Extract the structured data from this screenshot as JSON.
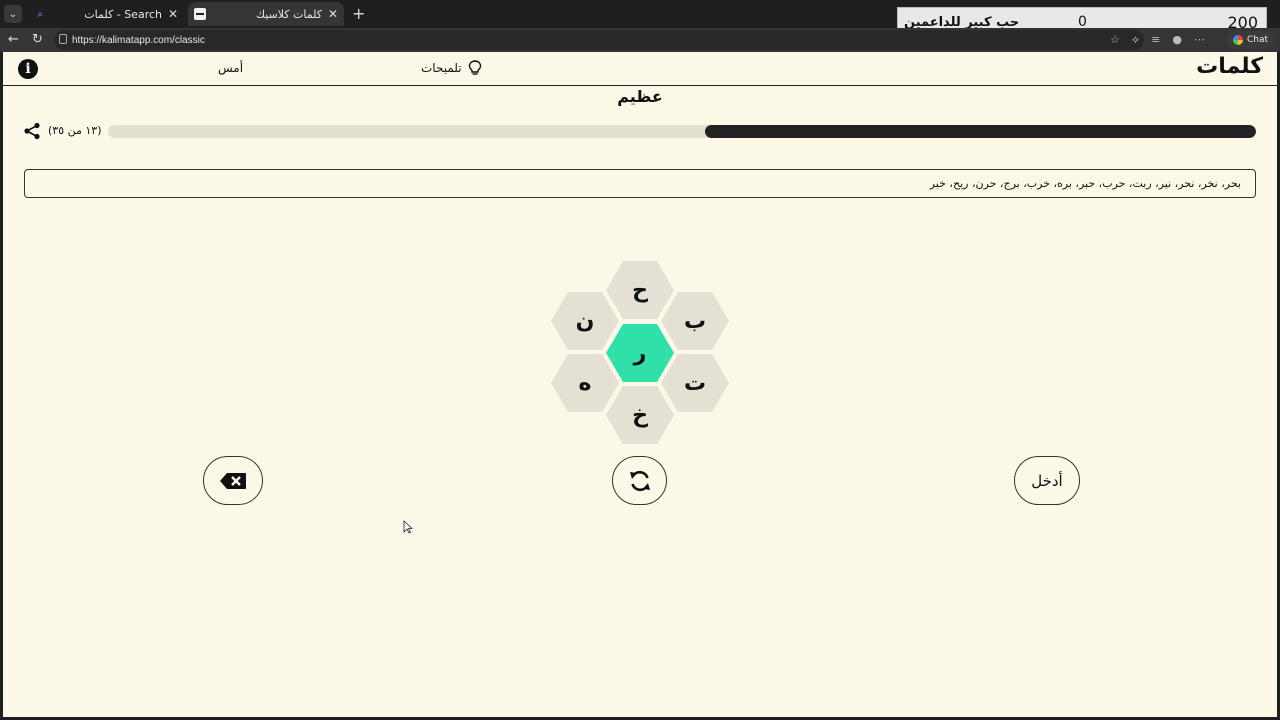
{
  "browser": {
    "tabs": [
      {
        "title": "كلمات - Search",
        "active": false,
        "icon": "search-icon"
      },
      {
        "title": "كلمات كلاسيك",
        "active": true,
        "icon": "site-favicon"
      }
    ],
    "url": "https://kalimatapp.com/classic",
    "chat_label": "Chat"
  },
  "overlay": {
    "label": "حب كبير للداعمين",
    "middle_value": "0",
    "right_value": "200"
  },
  "header": {
    "logo": "كلمات",
    "hints_label": "تلميحات",
    "yesterday_label": "أمس"
  },
  "game": {
    "rank": "عظيم",
    "progress_text": "(١٣ من ٣٥)",
    "progress_fraction": 0.48,
    "found_words": "بحر، نخر، نحر، نير، ربت، حرب، حبر، بره، خرب، برج، حرن، ريح، خبر",
    "letters": {
      "center": "ر",
      "top": "ح",
      "top_right": "ب",
      "bottom_right": "ت",
      "bottom": "خ",
      "bottom_left": "ه",
      "top_left": "ن"
    },
    "enter_label": "أدخل",
    "colors": {
      "center_hex": "#2fe0a8",
      "outer_hex": "#e4e0d3",
      "background": "#fcf8e8"
    }
  }
}
